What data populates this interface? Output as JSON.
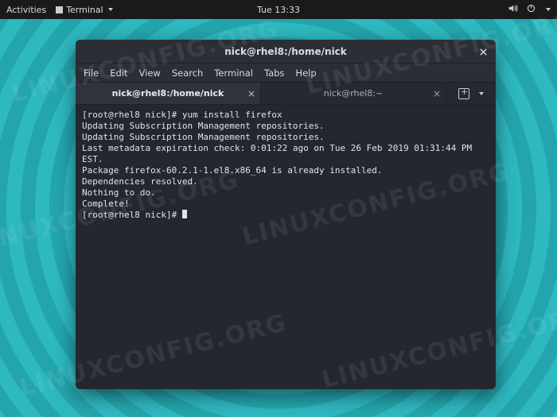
{
  "topbar": {
    "activities": "Activities",
    "app_name": "Terminal",
    "clock": "Tue 13:33"
  },
  "window": {
    "title": "nick@rhel8:/home/nick",
    "menu": [
      "File",
      "Edit",
      "View",
      "Search",
      "Terminal",
      "Tabs",
      "Help"
    ],
    "tabs": [
      {
        "label": "nick@rhel8:/home/nick",
        "active": true
      },
      {
        "label": "nick@rhel8:~",
        "active": false
      }
    ]
  },
  "terminal": {
    "lines": [
      "[root@rhel8 nick]# yum install firefox",
      "Updating Subscription Management repositories.",
      "Updating Subscription Management repositories.",
      "Last metadata expiration check: 0:01:22 ago on Tue 26 Feb 2019 01:31:44 PM EST.",
      "Package firefox-60.2.1-1.el8.x86_64 is already installed.",
      "Dependencies resolved.",
      "Nothing to do.",
      "Complete!",
      "[root@rhel8 nick]# "
    ]
  },
  "watermark": "LINUXCONFIG.ORG"
}
